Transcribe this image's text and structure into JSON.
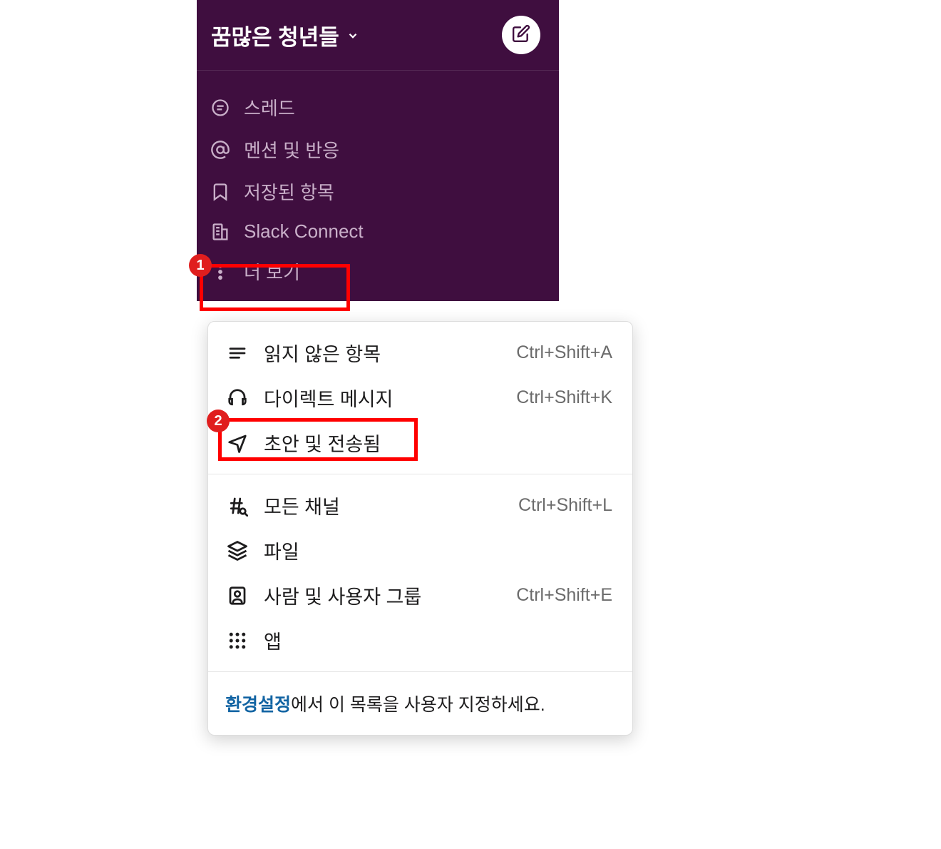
{
  "workspace": {
    "name": "꿈많은 청년들"
  },
  "sidebar": {
    "items": [
      {
        "label": "스레드",
        "icon": "thread"
      },
      {
        "label": "멘션 및 반응",
        "icon": "mention"
      },
      {
        "label": "저장된 항목",
        "icon": "bookmark"
      },
      {
        "label": "Slack Connect",
        "icon": "building"
      },
      {
        "label": "더 보기",
        "icon": "more"
      }
    ]
  },
  "annotations": {
    "badge1": "1",
    "badge2": "2"
  },
  "popover": {
    "section1": [
      {
        "label": "읽지 않은 항목",
        "shortcut": "Ctrl+Shift+A",
        "icon": "list"
      },
      {
        "label": "다이렉트 메시지",
        "shortcut": "Ctrl+Shift+K",
        "icon": "headset"
      },
      {
        "label": "초안 및 전송됨",
        "shortcut": "",
        "icon": "send"
      }
    ],
    "section2": [
      {
        "label": "모든 채널",
        "shortcut": "Ctrl+Shift+L",
        "icon": "hash"
      },
      {
        "label": "파일",
        "shortcut": "",
        "icon": "layers"
      },
      {
        "label": "사람 및 사용자 그룹",
        "shortcut": "Ctrl+Shift+E",
        "icon": "contacts"
      },
      {
        "label": "앱",
        "shortcut": "",
        "icon": "apps"
      }
    ],
    "footer": {
      "link": "환경설정",
      "text": "에서 이 목록을 사용자 지정하세요."
    }
  }
}
